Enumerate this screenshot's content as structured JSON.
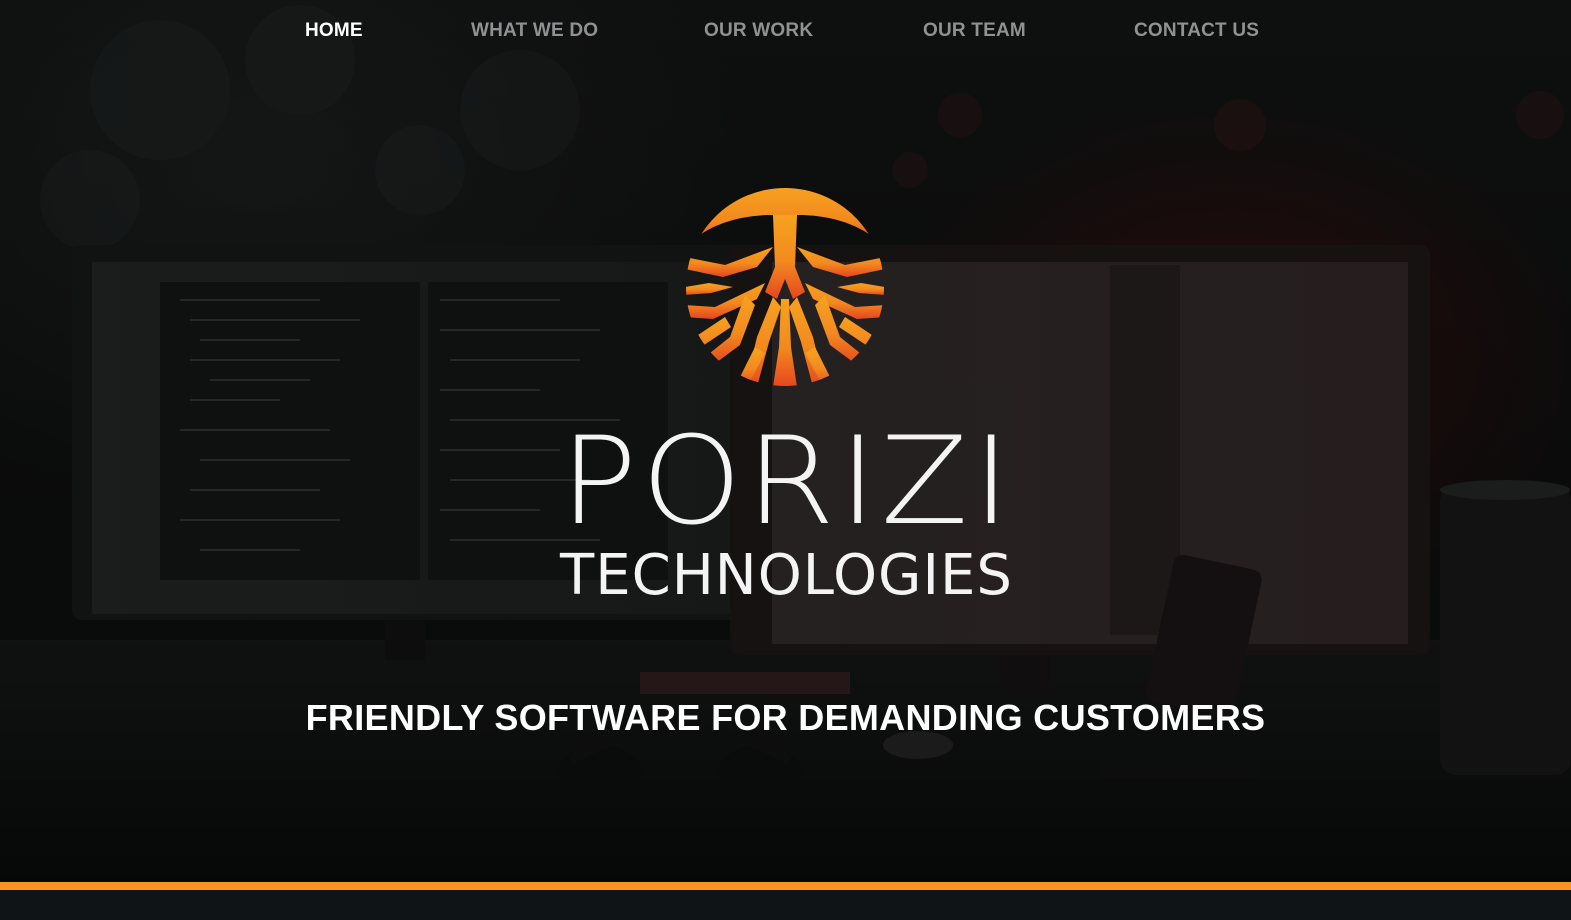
{
  "nav": {
    "items": [
      {
        "label": "HOME",
        "active": true
      },
      {
        "label": "WHAT WE DO",
        "active": false
      },
      {
        "label": "OUR WORK",
        "active": false
      },
      {
        "label": "OUR TEAM",
        "active": false
      },
      {
        "label": "CONTACT US",
        "active": false
      }
    ]
  },
  "brand": {
    "name": "PORIZI",
    "subtitle": "TECHNOLOGIES",
    "logo_icon": "tree-roots-circle-icon",
    "logo_gradient_top": "#f7a21f",
    "logo_gradient_bottom": "#e6461f"
  },
  "hero": {
    "tagline": "FRIENDLY SOFTWARE FOR DEMANDING CUSTOMERS",
    "background_image": "dark-desk-with-monitors-photo"
  },
  "colors": {
    "accent": "#f7941d",
    "footer_background": "#0f1416",
    "nav_active": "#ffffff",
    "nav_inactive": "#8f9192"
  }
}
